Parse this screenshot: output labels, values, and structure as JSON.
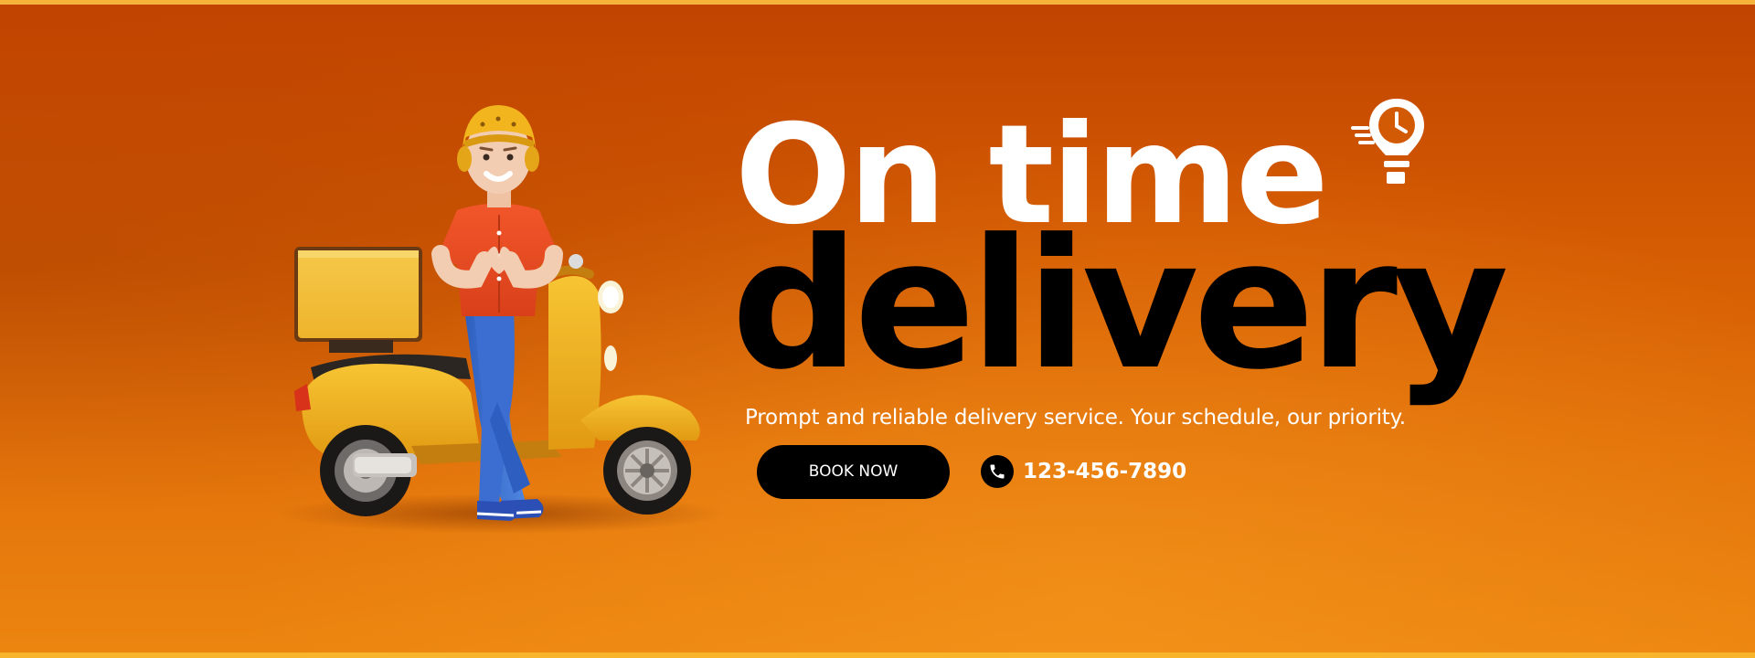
{
  "hero": {
    "headline_line1": "On time",
    "headline_line2": "delivery",
    "tagline": "Prompt and reliable delivery service. Your schedule, our priority.",
    "cta_label": "BOOK NOW",
    "phone_number": "123-456-7890"
  },
  "icons": {
    "phone": "phone-icon",
    "clock": "fast-clock-pin-icon",
    "illustration": "delivery-man-scooter-illustration"
  },
  "colors": {
    "background_top": "#c04300",
    "background_bottom": "#ec8510",
    "headline_primary": "#ffffff",
    "headline_secondary": "#000000",
    "button_background": "#000000",
    "border_accent": "#f6b33c"
  }
}
